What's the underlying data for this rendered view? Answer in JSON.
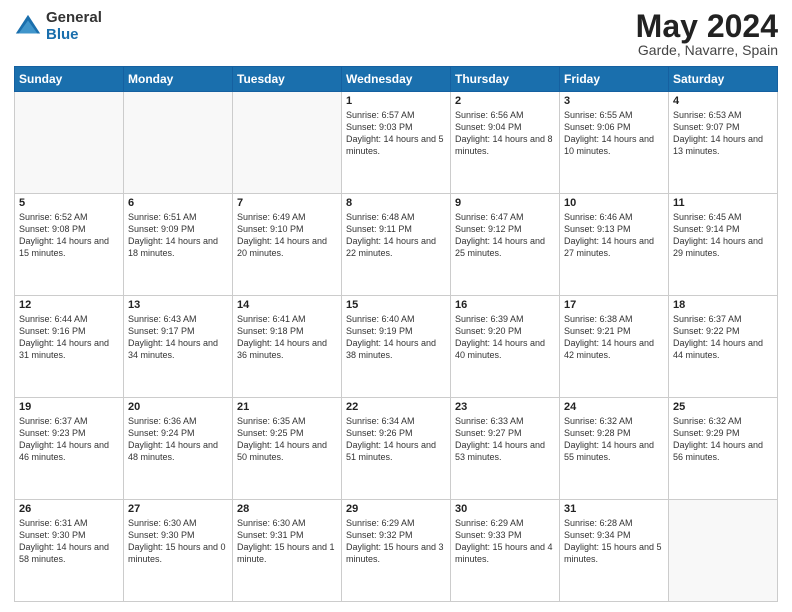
{
  "header": {
    "logo_general": "General",
    "logo_blue": "Blue",
    "title": "May 2024",
    "location": "Garde, Navarre, Spain"
  },
  "days_of_week": [
    "Sunday",
    "Monday",
    "Tuesday",
    "Wednesday",
    "Thursday",
    "Friday",
    "Saturday"
  ],
  "weeks": [
    [
      {
        "day": "",
        "sunrise": "",
        "sunset": "",
        "daylight": "",
        "empty": true
      },
      {
        "day": "",
        "sunrise": "",
        "sunset": "",
        "daylight": "",
        "empty": true
      },
      {
        "day": "",
        "sunrise": "",
        "sunset": "",
        "daylight": "",
        "empty": true
      },
      {
        "day": "1",
        "sunrise": "Sunrise: 6:57 AM",
        "sunset": "Sunset: 9:03 PM",
        "daylight": "Daylight: 14 hours and 5 minutes.",
        "empty": false
      },
      {
        "day": "2",
        "sunrise": "Sunrise: 6:56 AM",
        "sunset": "Sunset: 9:04 PM",
        "daylight": "Daylight: 14 hours and 8 minutes.",
        "empty": false
      },
      {
        "day": "3",
        "sunrise": "Sunrise: 6:55 AM",
        "sunset": "Sunset: 9:06 PM",
        "daylight": "Daylight: 14 hours and 10 minutes.",
        "empty": false
      },
      {
        "day": "4",
        "sunrise": "Sunrise: 6:53 AM",
        "sunset": "Sunset: 9:07 PM",
        "daylight": "Daylight: 14 hours and 13 minutes.",
        "empty": false
      }
    ],
    [
      {
        "day": "5",
        "sunrise": "Sunrise: 6:52 AM",
        "sunset": "Sunset: 9:08 PM",
        "daylight": "Daylight: 14 hours and 15 minutes.",
        "empty": false
      },
      {
        "day": "6",
        "sunrise": "Sunrise: 6:51 AM",
        "sunset": "Sunset: 9:09 PM",
        "daylight": "Daylight: 14 hours and 18 minutes.",
        "empty": false
      },
      {
        "day": "7",
        "sunrise": "Sunrise: 6:49 AM",
        "sunset": "Sunset: 9:10 PM",
        "daylight": "Daylight: 14 hours and 20 minutes.",
        "empty": false
      },
      {
        "day": "8",
        "sunrise": "Sunrise: 6:48 AM",
        "sunset": "Sunset: 9:11 PM",
        "daylight": "Daylight: 14 hours and 22 minutes.",
        "empty": false
      },
      {
        "day": "9",
        "sunrise": "Sunrise: 6:47 AM",
        "sunset": "Sunset: 9:12 PM",
        "daylight": "Daylight: 14 hours and 25 minutes.",
        "empty": false
      },
      {
        "day": "10",
        "sunrise": "Sunrise: 6:46 AM",
        "sunset": "Sunset: 9:13 PM",
        "daylight": "Daylight: 14 hours and 27 minutes.",
        "empty": false
      },
      {
        "day": "11",
        "sunrise": "Sunrise: 6:45 AM",
        "sunset": "Sunset: 9:14 PM",
        "daylight": "Daylight: 14 hours and 29 minutes.",
        "empty": false
      }
    ],
    [
      {
        "day": "12",
        "sunrise": "Sunrise: 6:44 AM",
        "sunset": "Sunset: 9:16 PM",
        "daylight": "Daylight: 14 hours and 31 minutes.",
        "empty": false
      },
      {
        "day": "13",
        "sunrise": "Sunrise: 6:43 AM",
        "sunset": "Sunset: 9:17 PM",
        "daylight": "Daylight: 14 hours and 34 minutes.",
        "empty": false
      },
      {
        "day": "14",
        "sunrise": "Sunrise: 6:41 AM",
        "sunset": "Sunset: 9:18 PM",
        "daylight": "Daylight: 14 hours and 36 minutes.",
        "empty": false
      },
      {
        "day": "15",
        "sunrise": "Sunrise: 6:40 AM",
        "sunset": "Sunset: 9:19 PM",
        "daylight": "Daylight: 14 hours and 38 minutes.",
        "empty": false
      },
      {
        "day": "16",
        "sunrise": "Sunrise: 6:39 AM",
        "sunset": "Sunset: 9:20 PM",
        "daylight": "Daylight: 14 hours and 40 minutes.",
        "empty": false
      },
      {
        "day": "17",
        "sunrise": "Sunrise: 6:38 AM",
        "sunset": "Sunset: 9:21 PM",
        "daylight": "Daylight: 14 hours and 42 minutes.",
        "empty": false
      },
      {
        "day": "18",
        "sunrise": "Sunrise: 6:37 AM",
        "sunset": "Sunset: 9:22 PM",
        "daylight": "Daylight: 14 hours and 44 minutes.",
        "empty": false
      }
    ],
    [
      {
        "day": "19",
        "sunrise": "Sunrise: 6:37 AM",
        "sunset": "Sunset: 9:23 PM",
        "daylight": "Daylight: 14 hours and 46 minutes.",
        "empty": false
      },
      {
        "day": "20",
        "sunrise": "Sunrise: 6:36 AM",
        "sunset": "Sunset: 9:24 PM",
        "daylight": "Daylight: 14 hours and 48 minutes.",
        "empty": false
      },
      {
        "day": "21",
        "sunrise": "Sunrise: 6:35 AM",
        "sunset": "Sunset: 9:25 PM",
        "daylight": "Daylight: 14 hours and 50 minutes.",
        "empty": false
      },
      {
        "day": "22",
        "sunrise": "Sunrise: 6:34 AM",
        "sunset": "Sunset: 9:26 PM",
        "daylight": "Daylight: 14 hours and 51 minutes.",
        "empty": false
      },
      {
        "day": "23",
        "sunrise": "Sunrise: 6:33 AM",
        "sunset": "Sunset: 9:27 PM",
        "daylight": "Daylight: 14 hours and 53 minutes.",
        "empty": false
      },
      {
        "day": "24",
        "sunrise": "Sunrise: 6:32 AM",
        "sunset": "Sunset: 9:28 PM",
        "daylight": "Daylight: 14 hours and 55 minutes.",
        "empty": false
      },
      {
        "day": "25",
        "sunrise": "Sunrise: 6:32 AM",
        "sunset": "Sunset: 9:29 PM",
        "daylight": "Daylight: 14 hours and 56 minutes.",
        "empty": false
      }
    ],
    [
      {
        "day": "26",
        "sunrise": "Sunrise: 6:31 AM",
        "sunset": "Sunset: 9:30 PM",
        "daylight": "Daylight: 14 hours and 58 minutes.",
        "empty": false
      },
      {
        "day": "27",
        "sunrise": "Sunrise: 6:30 AM",
        "sunset": "Sunset: 9:30 PM",
        "daylight": "Daylight: 15 hours and 0 minutes.",
        "empty": false
      },
      {
        "day": "28",
        "sunrise": "Sunrise: 6:30 AM",
        "sunset": "Sunset: 9:31 PM",
        "daylight": "Daylight: 15 hours and 1 minute.",
        "empty": false
      },
      {
        "day": "29",
        "sunrise": "Sunrise: 6:29 AM",
        "sunset": "Sunset: 9:32 PM",
        "daylight": "Daylight: 15 hours and 3 minutes.",
        "empty": false
      },
      {
        "day": "30",
        "sunrise": "Sunrise: 6:29 AM",
        "sunset": "Sunset: 9:33 PM",
        "daylight": "Daylight: 15 hours and 4 minutes.",
        "empty": false
      },
      {
        "day": "31",
        "sunrise": "Sunrise: 6:28 AM",
        "sunset": "Sunset: 9:34 PM",
        "daylight": "Daylight: 15 hours and 5 minutes.",
        "empty": false
      },
      {
        "day": "",
        "sunrise": "",
        "sunset": "",
        "daylight": "",
        "empty": true
      }
    ]
  ]
}
